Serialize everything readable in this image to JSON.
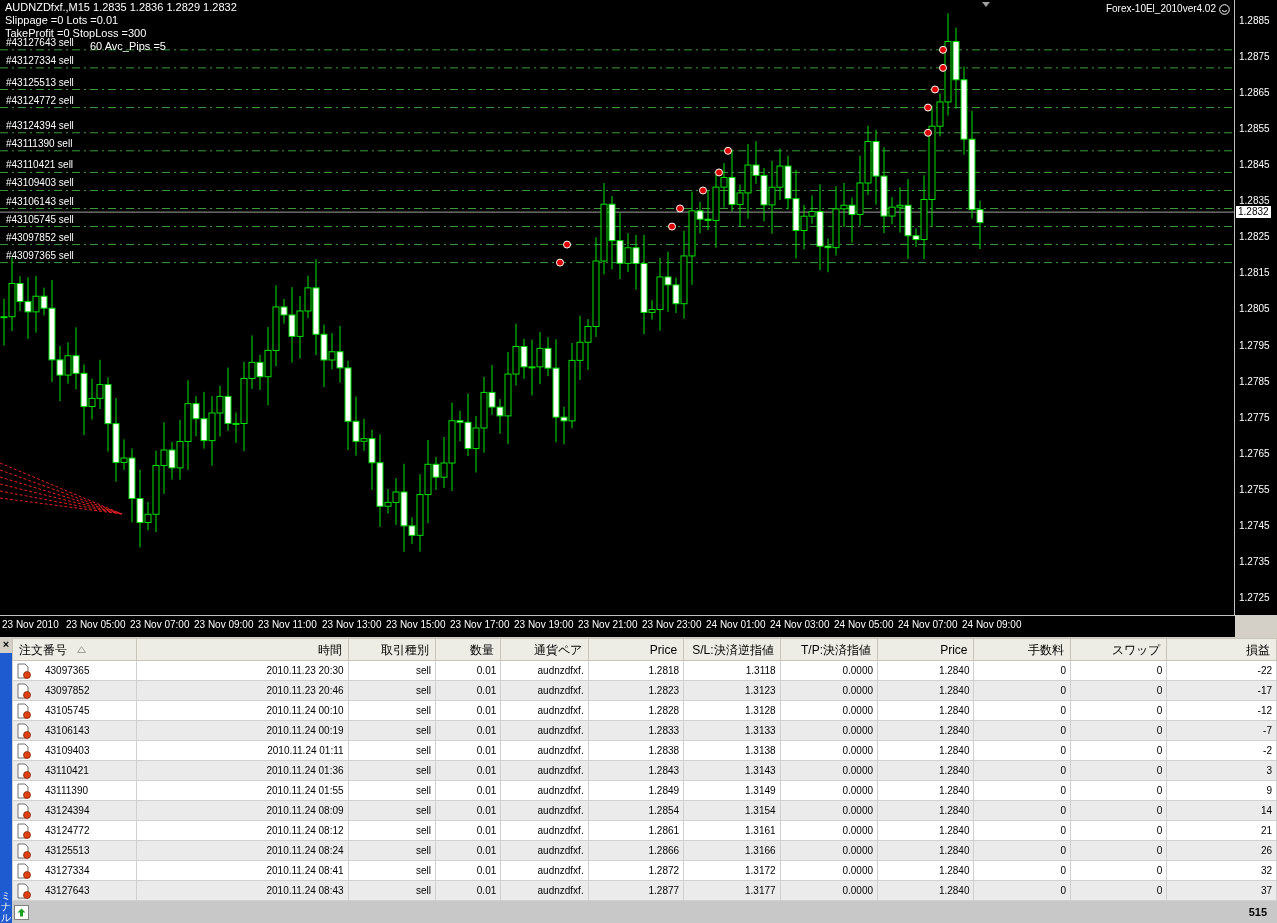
{
  "chart": {
    "title": "AUDNZDfxf.,M15  1.2835 1.2836 1.2829 1.2832",
    "info_lines": [
      "Slippage =0 Lots =0.01",
      "TakeProfit =0 StopLoss =300"
    ],
    "overlay_text": "60 Avc_Pips =5",
    "expert": "Forex-10El_2010ver4.02",
    "order_labels": [
      "#43127643 sell",
      "#43127334 sell",
      "#43125513 sell",
      "#43124772 sell",
      "#43124394 sell",
      "#43111390 sell",
      "#43110421 sell",
      "#43109403 sell",
      "#43106143 sell",
      "#43105745 sell",
      "#43097852 sell",
      "#43097365 sell"
    ],
    "price_ticks": [
      "1.2885",
      "1.2875",
      "1.2865",
      "1.2855",
      "1.2845",
      "1.2835",
      "1.2825",
      "1.2815",
      "1.2805",
      "1.2795",
      "1.2785",
      "1.2775",
      "1.2765",
      "1.2755",
      "1.2745",
      "1.2735",
      "1.2725"
    ],
    "current_price": "1.2832",
    "time_labels": [
      "23 Nov 2010",
      "23 Nov 05:00",
      "23 Nov 07:00",
      "23 Nov 09:00",
      "23 Nov 11:00",
      "23 Nov 13:00",
      "23 Nov 15:00",
      "23 Nov 17:00",
      "23 Nov 19:00",
      "23 Nov 21:00",
      "23 Nov 23:00",
      "24 Nov 01:00",
      "24 Nov 03:00",
      "24 Nov 05:00",
      "24 Nov 07:00",
      "24 Nov 09:00"
    ]
  },
  "terminal": {
    "close": "×",
    "side_tab": "ミナル",
    "columns": [
      {
        "label": "注文番号",
        "sorted": true
      },
      {
        "label": "時間",
        "sorted": false
      },
      {
        "label": "取引種別",
        "sorted": false
      },
      {
        "label": "数量",
        "sorted": false
      },
      {
        "label": "通貨ペア",
        "sorted": false
      },
      {
        "label": "Price",
        "sorted": false
      },
      {
        "label": "S/L:決済逆指値",
        "sorted": false
      },
      {
        "label": "T/P:決済指値",
        "sorted": false
      },
      {
        "label": "Price",
        "sorted": false
      },
      {
        "label": "手数料",
        "sorted": false
      },
      {
        "label": "スワップ",
        "sorted": false
      },
      {
        "label": "損益",
        "sorted": false
      }
    ],
    "rows": [
      [
        "43097365",
        "2010.11.23 20:30",
        "sell",
        "0.01",
        "audnzdfxf.",
        "1.2818",
        "1.3118",
        "0.0000",
        "1.2840",
        "0",
        "0",
        "-22"
      ],
      [
        "43097852",
        "2010.11.23 20:46",
        "sell",
        "0.01",
        "audnzdfxf.",
        "1.2823",
        "1.3123",
        "0.0000",
        "1.2840",
        "0",
        "0",
        "-17"
      ],
      [
        "43105745",
        "2010.11.24 00:10",
        "sell",
        "0.01",
        "audnzdfxf.",
        "1.2828",
        "1.3128",
        "0.0000",
        "1.2840",
        "0",
        "0",
        "-12"
      ],
      [
        "43106143",
        "2010.11.24 00:19",
        "sell",
        "0.01",
        "audnzdfxf.",
        "1.2833",
        "1.3133",
        "0.0000",
        "1.2840",
        "0",
        "0",
        "-7"
      ],
      [
        "43109403",
        "2010.11.24 01:11",
        "sell",
        "0.01",
        "audnzdfxf.",
        "1.2838",
        "1.3138",
        "0.0000",
        "1.2840",
        "0",
        "0",
        "-2"
      ],
      [
        "43110421",
        "2010.11.24 01:36",
        "sell",
        "0.01",
        "audnzdfxf.",
        "1.2843",
        "1.3143",
        "0.0000",
        "1.2840",
        "0",
        "0",
        "3"
      ],
      [
        "43111390",
        "2010.11.24 01:55",
        "sell",
        "0.01",
        "audnzdfxf.",
        "1.2849",
        "1.3149",
        "0.0000",
        "1.2840",
        "0",
        "0",
        "9"
      ],
      [
        "43124394",
        "2010.11.24 08:09",
        "sell",
        "0.01",
        "audnzdfxf.",
        "1.2854",
        "1.3154",
        "0.0000",
        "1.2840",
        "0",
        "0",
        "14"
      ],
      [
        "43124772",
        "2010.11.24 08:12",
        "sell",
        "0.01",
        "audnzdfxf.",
        "1.2861",
        "1.3161",
        "0.0000",
        "1.2840",
        "0",
        "0",
        "21"
      ],
      [
        "43125513",
        "2010.11.24 08:24",
        "sell",
        "0.01",
        "audnzdfxf.",
        "1.2866",
        "1.3166",
        "0.0000",
        "1.2840",
        "0",
        "0",
        "26"
      ],
      [
        "43127334",
        "2010.11.24 08:41",
        "sell",
        "0.01",
        "audnzdfxf.",
        "1.2872",
        "1.3172",
        "0.0000",
        "1.2840",
        "0",
        "0",
        "32"
      ],
      [
        "43127643",
        "2010.11.24 08:43",
        "sell",
        "0.01",
        "audnzdfxf.",
        "1.2877",
        "1.3177",
        "0.0000",
        "1.2840",
        "0",
        "0",
        "37"
      ]
    ],
    "total": "515"
  }
}
